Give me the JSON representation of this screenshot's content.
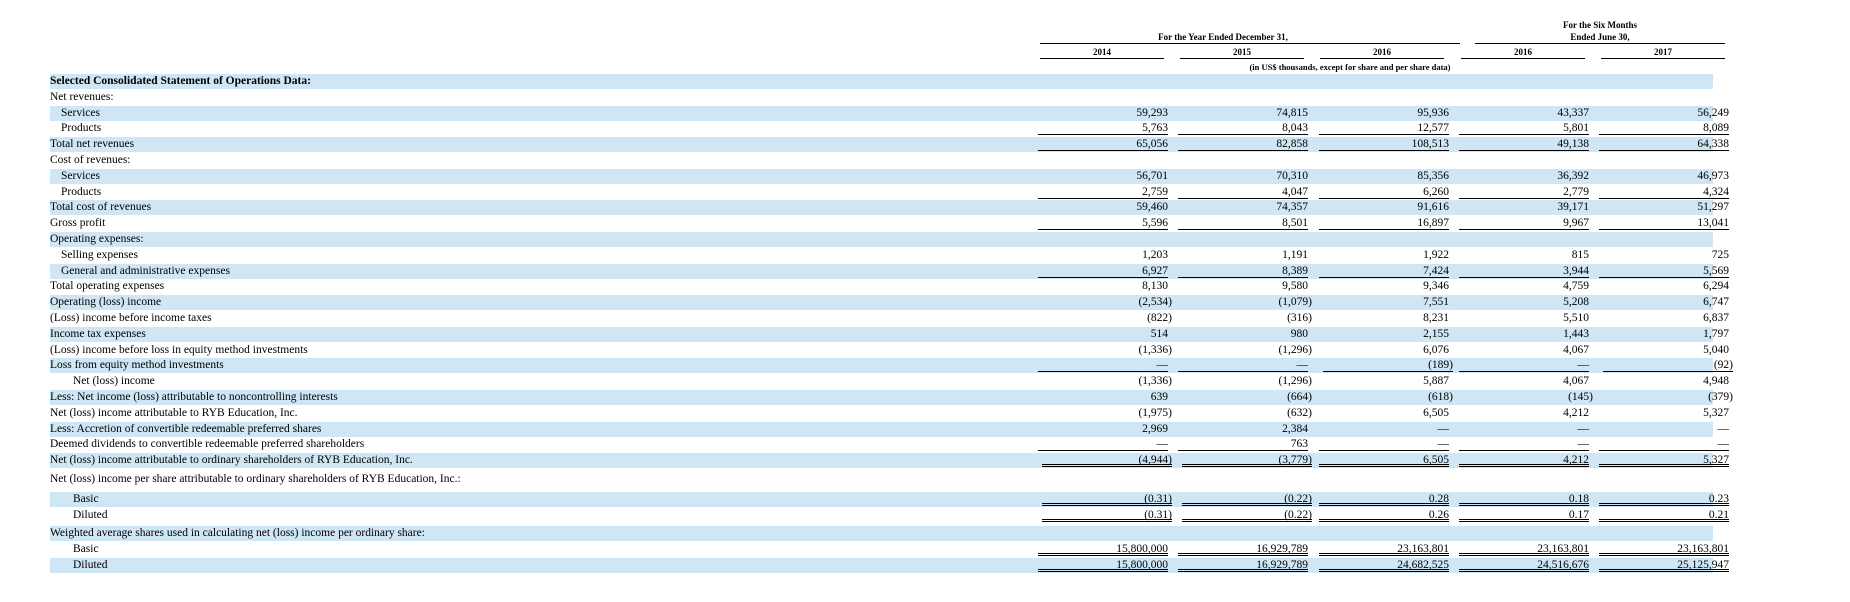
{
  "header": {
    "year_ended": "For the Year Ended December 31,",
    "six_months_line1": "For the Six Months",
    "six_months_line2": "Ended June 30,",
    "years": [
      "2014",
      "2015",
      "2016",
      "2016",
      "2017"
    ],
    "units": "(in US$ thousands, except for share and per share data)"
  },
  "rows": [
    {
      "label": "Selected Consolidated Statement of Operations Data:",
      "bold": true,
      "indent": 0,
      "shaded": true,
      "values": []
    },
    {
      "label": "Net revenues:",
      "indent": 0,
      "shaded": false,
      "values": []
    },
    {
      "label": "Services",
      "indent": 1,
      "shaded": true,
      "values": [
        "59,293",
        "74,815",
        "95,936",
        "43,337",
        "56,249"
      ]
    },
    {
      "label": "Products",
      "indent": 1,
      "shaded": false,
      "values": [
        "5,763",
        "8,043",
        "12,577",
        "5,801",
        "8,089"
      ]
    },
    {
      "label": "Total net revenues",
      "indent": 0,
      "shaded": true,
      "values": [
        "65,056",
        "82,858",
        "108,513",
        "49,138",
        "64,338"
      ]
    },
    {
      "label": "Cost of revenues:",
      "indent": 0,
      "shaded": false,
      "values": []
    },
    {
      "label": "Services",
      "indent": 1,
      "shaded": true,
      "values": [
        "56,701",
        "70,310",
        "85,356",
        "36,392",
        "46,973"
      ]
    },
    {
      "label": "Products",
      "indent": 1,
      "shaded": false,
      "values": [
        "2,759",
        "4,047",
        "6,260",
        "2,779",
        "4,324"
      ]
    },
    {
      "label": "Total cost of revenues",
      "indent": 0,
      "shaded": true,
      "values": [
        "59,460",
        "74,357",
        "91,616",
        "39,171",
        "51,297"
      ]
    },
    {
      "label": "Gross profit",
      "indent": 0,
      "shaded": false,
      "values": [
        "5,596",
        "8,501",
        "16,897",
        "9,967",
        "13,041"
      ]
    },
    {
      "label": "Operating expenses:",
      "indent": 0,
      "shaded": true,
      "values": []
    },
    {
      "label": "Selling expenses",
      "indent": 1,
      "shaded": false,
      "values": [
        "1,203",
        "1,191",
        "1,922",
        "815",
        "725"
      ]
    },
    {
      "label": "General and administrative expenses",
      "indent": 1,
      "shaded": true,
      "values": [
        "6,927",
        "8,389",
        "7,424",
        "3,944",
        "5,569"
      ]
    },
    {
      "label": "Total operating expenses",
      "indent": 0,
      "shaded": false,
      "values": [
        "8,130",
        "9,580",
        "9,346",
        "4,759",
        "6,294"
      ]
    },
    {
      "label": "Operating (loss) income",
      "indent": 0,
      "shaded": true,
      "values": [
        "(2,534)",
        "(1,079)",
        "7,551",
        "5,208",
        "6,747"
      ]
    },
    {
      "label": "(Loss) income before income taxes",
      "indent": 0,
      "shaded": false,
      "values": [
        "(822)",
        "(316)",
        "8,231",
        "5,510",
        "6,837"
      ]
    },
    {
      "label": "Income tax expenses",
      "indent": 0,
      "shaded": true,
      "values": [
        "514",
        "980",
        "2,155",
        "1,443",
        "1,797"
      ]
    },
    {
      "label": "(Loss) income before loss in equity method investments",
      "indent": 0,
      "shaded": false,
      "values": [
        "(1,336)",
        "(1,296)",
        "6,076",
        "4,067",
        "5,040"
      ]
    },
    {
      "label": "Loss from equity method investments",
      "indent": 0,
      "shaded": true,
      "values": [
        "—",
        "—",
        "(189)",
        "—",
        "(92)"
      ]
    },
    {
      "label": "Net (loss) income",
      "indent": 2,
      "shaded": false,
      "values": [
        "(1,336)",
        "(1,296)",
        "5,887",
        "4,067",
        "4,948"
      ]
    },
    {
      "label": "Less: Net income (loss) attributable to noncontrolling interests",
      "indent": 0,
      "shaded": true,
      "values": [
        "639",
        "(664)",
        "(618)",
        "(145)",
        "(379)"
      ]
    },
    {
      "label": "Net (loss) income attributable to RYB Education, Inc.",
      "indent": 0,
      "shaded": false,
      "values": [
        "(1,975)",
        "(632)",
        "6,505",
        "4,212",
        "5,327"
      ]
    },
    {
      "label": "Less: Accretion of convertible redeemable preferred shares",
      "indent": 0,
      "shaded": true,
      "values": [
        "2,969",
        "2,384",
        "—",
        "—",
        "—"
      ]
    },
    {
      "label": "Deemed dividends to convertible redeemable preferred shareholders",
      "indent": 0,
      "shaded": false,
      "values": [
        "—",
        "763",
        "—",
        "—",
        "—"
      ]
    },
    {
      "label": "Net (loss) income attributable to ordinary shareholders of RYB Education, Inc.",
      "indent": 0,
      "shaded": true,
      "values": [
        "(4,944)",
        "(3,779)",
        "6,505",
        "4,212",
        "5,327"
      ]
    },
    {
      "label": "Net (loss) income per share attributable to ordinary shareholders of RYB Education, Inc.:",
      "indent": 0,
      "shaded": false,
      "values": []
    },
    {
      "label": "Basic",
      "indent": 2,
      "shaded": true,
      "values": [
        "(0.31)",
        "(0.22)",
        "0.28",
        "0.18",
        "0.23"
      ]
    },
    {
      "label": "Diluted",
      "indent": 2,
      "shaded": false,
      "values": [
        "(0.31)",
        "(0.22)",
        "0.26",
        "0.17",
        "0.21"
      ]
    },
    {
      "label": "Weighted average shares used in calculating net (loss) income per ordinary share:",
      "indent": 0,
      "shaded": true,
      "values": []
    },
    {
      "label": "Basic",
      "indent": 2,
      "shaded": false,
      "values": [
        "15,800,000",
        "16,929,789",
        "23,163,801",
        "23,163,801",
        "23,163,801"
      ]
    },
    {
      "label": "Diluted",
      "indent": 2,
      "shaded": true,
      "values": [
        "15,800,000",
        "16,929,789",
        "24,682,525",
        "24,516,676",
        "25,125,947"
      ]
    }
  ]
}
